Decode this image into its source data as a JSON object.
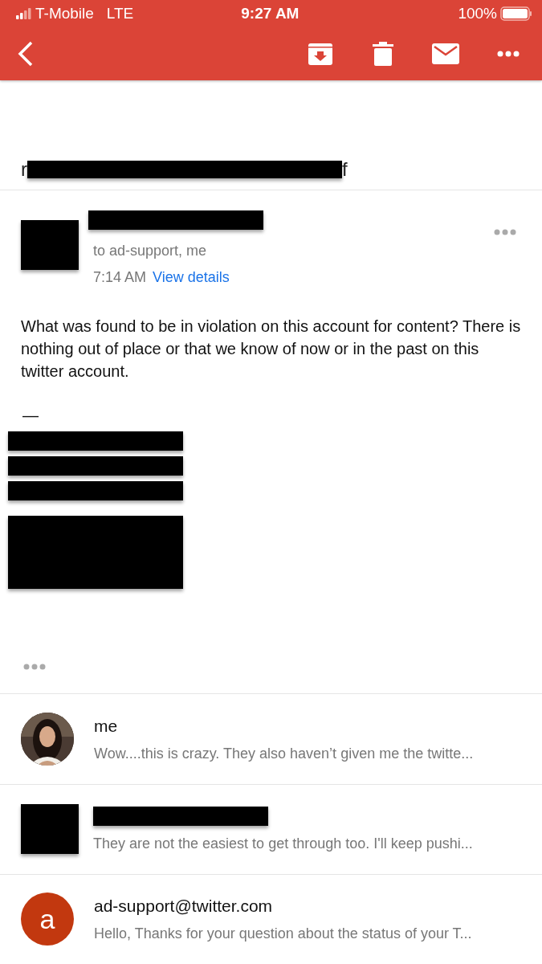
{
  "status_bar": {
    "carrier": "T-Mobile",
    "network": "LTE",
    "time": "9:27 AM",
    "battery": "100%"
  },
  "subject": {
    "start": "r",
    "end": "f"
  },
  "message": {
    "recipients": "to ad-support, me",
    "time": "7:14 AM",
    "details_link": "View details",
    "body": "What was found to be in violation on this account for content? There is nothing out of place or that we know of now or in the past on this twitter account.",
    "signature_dash": "—"
  },
  "thread": [
    {
      "sender": "me",
      "snippet": "Wow....this is crazy. They also haven’t given me the twitte..."
    },
    {
      "kind": "redacted",
      "snippet": "They are not the easiest to get through too. I'll keep pushi..."
    },
    {
      "kind": "letter",
      "initial": "a",
      "color": "#c2380f",
      "sender": "ad-support@twitter.com",
      "snippet": "Hello, Thanks for your question about the status of your T..."
    }
  ]
}
